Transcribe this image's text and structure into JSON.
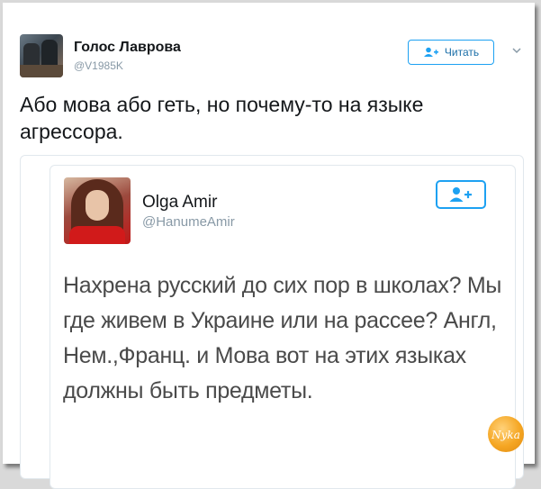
{
  "tweet": {
    "author_name": "Голос Лаврова",
    "author_handle": "@V1985K",
    "follow_label": "Читать",
    "text": "Або мова або геть, но почему-то на языке агрессора."
  },
  "quoted": {
    "author_name": "Olga Amir",
    "author_handle": "@HanumeAmir",
    "text": "Нахрена русский до сих пор в школах? Мы где живем в Украине или на рассее? Англ, Нем.,Франц. и Мова вот на этих языках должны быть предметы."
  },
  "watermark": "Nyka",
  "colors": {
    "accent": "#1da1f2",
    "text": "#14171a",
    "muted": "#8899a6"
  },
  "icons": {
    "follow": "follow-user-icon",
    "caret": "chevron-down-icon"
  }
}
